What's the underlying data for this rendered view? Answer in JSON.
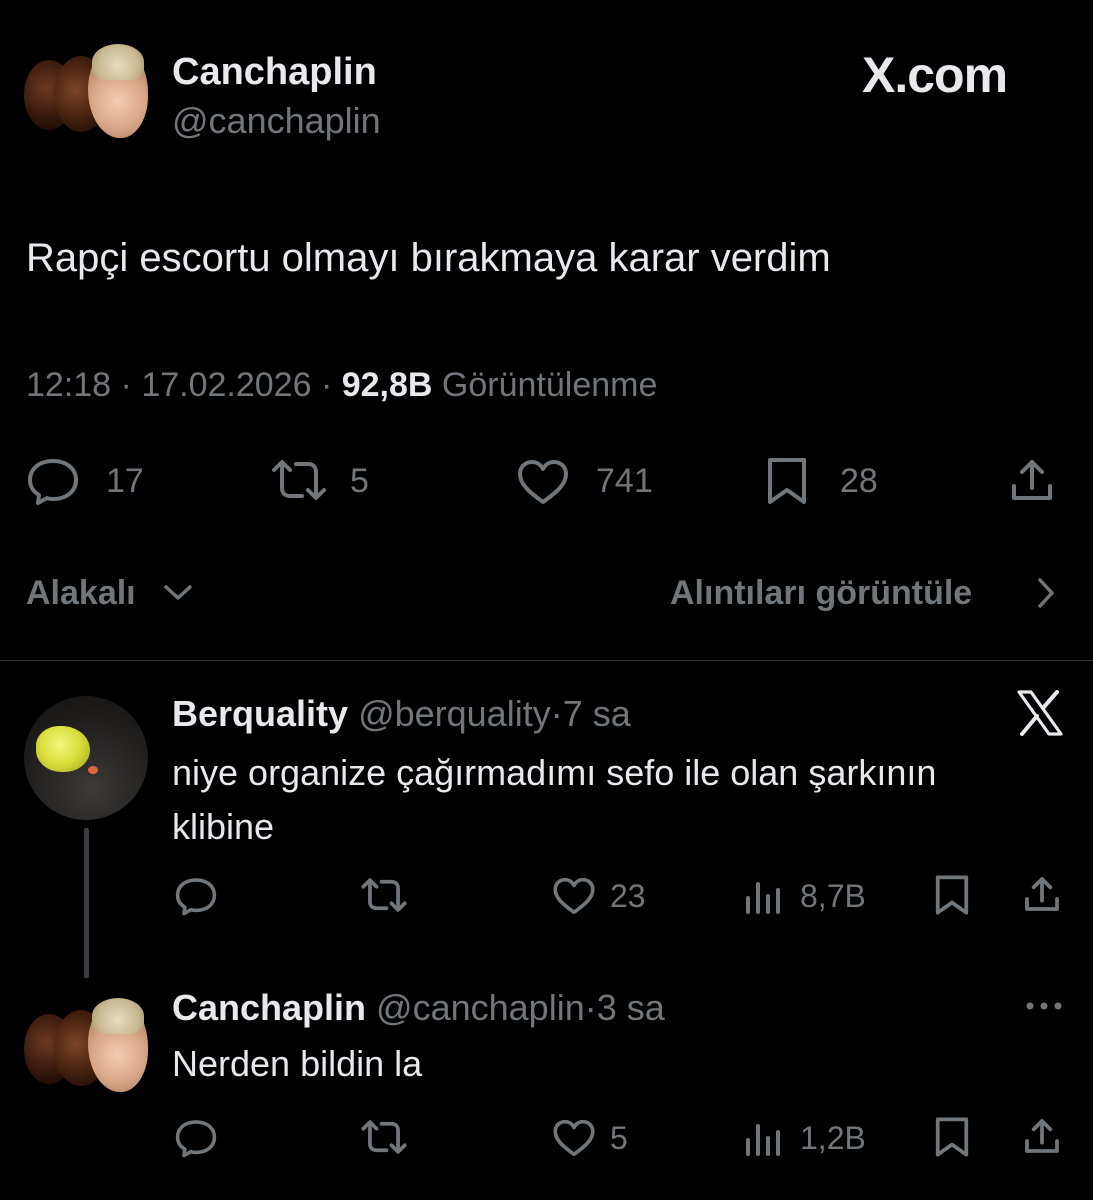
{
  "tweet": {
    "display_name": "Canchaplin",
    "handle": "@canchaplin",
    "brand": "X.com",
    "text": "Rapçi escortu olmayı bırakmaya karar verdim",
    "time": "12:18",
    "sep1": "·",
    "date": "17.02.2026",
    "sep2": "·",
    "views_count": "92,8B",
    "views_label": "Görüntülenme",
    "replies": "17",
    "retweets": "5",
    "likes": "741",
    "bookmarks": "28"
  },
  "filter": {
    "sort_label": "Alakalı",
    "quotes_label": "Alıntıları görüntüle"
  },
  "replies": [
    {
      "display_name": "Berquality",
      "handle": "@berquality",
      "sep": "·",
      "time": "7 sa",
      "text_line1": "niye organize çağırmadımı sefo ile olan şarkının",
      "text_line2": "klibine",
      "likes": "23",
      "views": "8,7B"
    },
    {
      "display_name": "Canchaplin",
      "handle": "@canchaplin",
      "sep": "·",
      "time": "3 sa",
      "text": "Nerden bildin la",
      "likes": "5",
      "views": "1,2B"
    }
  ],
  "colors": {
    "background": "#000000",
    "text": "#e7e9ea",
    "muted": "#71767b",
    "divider": "#2f3336"
  }
}
